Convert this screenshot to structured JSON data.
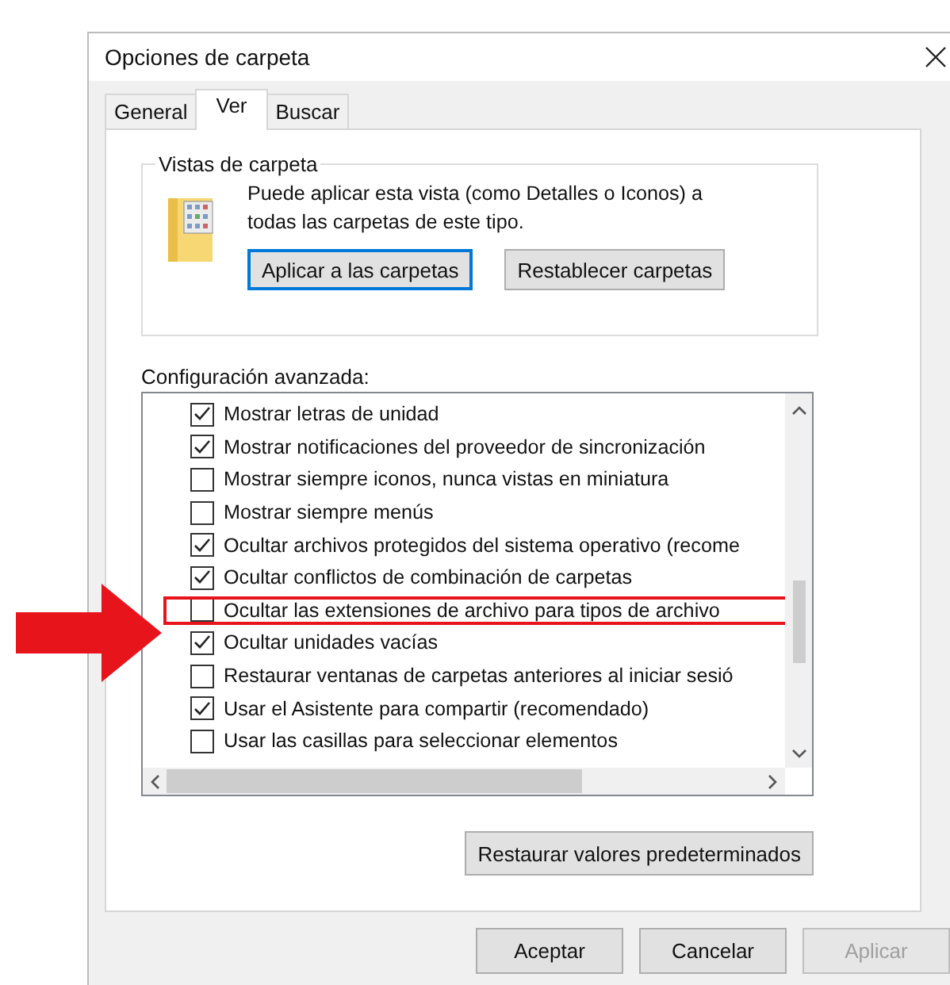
{
  "window": {
    "title": "Opciones de carpeta"
  },
  "tabs": [
    {
      "label": "General",
      "selected": false
    },
    {
      "label": "Ver",
      "selected": true
    },
    {
      "label": "Buscar",
      "selected": false
    }
  ],
  "folder_views": {
    "title": "Vistas de carpeta",
    "description": "Puede aplicar esta vista (como Detalles o Iconos) a todas las carpetas de este tipo.",
    "buttons": [
      {
        "label": "Aplicar a las carpetas",
        "focused": true
      },
      {
        "label": "Restablecer carpetas",
        "focused": false
      }
    ]
  },
  "advanced": {
    "label": "Configuración avanzada:",
    "items": [
      {
        "label": "Mostrar letras de unidad",
        "checked": true,
        "highlighted": false
      },
      {
        "label": "Mostrar notificaciones del proveedor de sincronización",
        "checked": true,
        "highlighted": false
      },
      {
        "label": "Mostrar siempre iconos, nunca vistas en miniatura",
        "checked": false,
        "highlighted": false
      },
      {
        "label": "Mostrar siempre menús",
        "checked": false,
        "highlighted": false
      },
      {
        "label": "Ocultar archivos protegidos del sistema operativo (recome",
        "checked": true,
        "highlighted": false
      },
      {
        "label": "Ocultar conflictos de combinación de carpetas",
        "checked": true,
        "highlighted": false
      },
      {
        "label": "Ocultar las extensiones de archivo para tipos de archivo",
        "checked": false,
        "highlighted": true
      },
      {
        "label": "Ocultar unidades vacías",
        "checked": true,
        "highlighted": false
      },
      {
        "label": "Restaurar ventanas de carpetas anteriores al iniciar sesió",
        "checked": false,
        "highlighted": false
      },
      {
        "label": "Usar el Asistente para compartir (recomendado)",
        "checked": true,
        "highlighted": false
      },
      {
        "label": "Usar las casillas para seleccionar elementos",
        "checked": false,
        "highlighted": false
      }
    ],
    "restore_button": "Restaurar valores predeterminados"
  },
  "footer_buttons": [
    {
      "label": "Aceptar",
      "disabled": false
    },
    {
      "label": "Cancelar",
      "disabled": false
    },
    {
      "label": "Aplicar",
      "disabled": true
    }
  ]
}
